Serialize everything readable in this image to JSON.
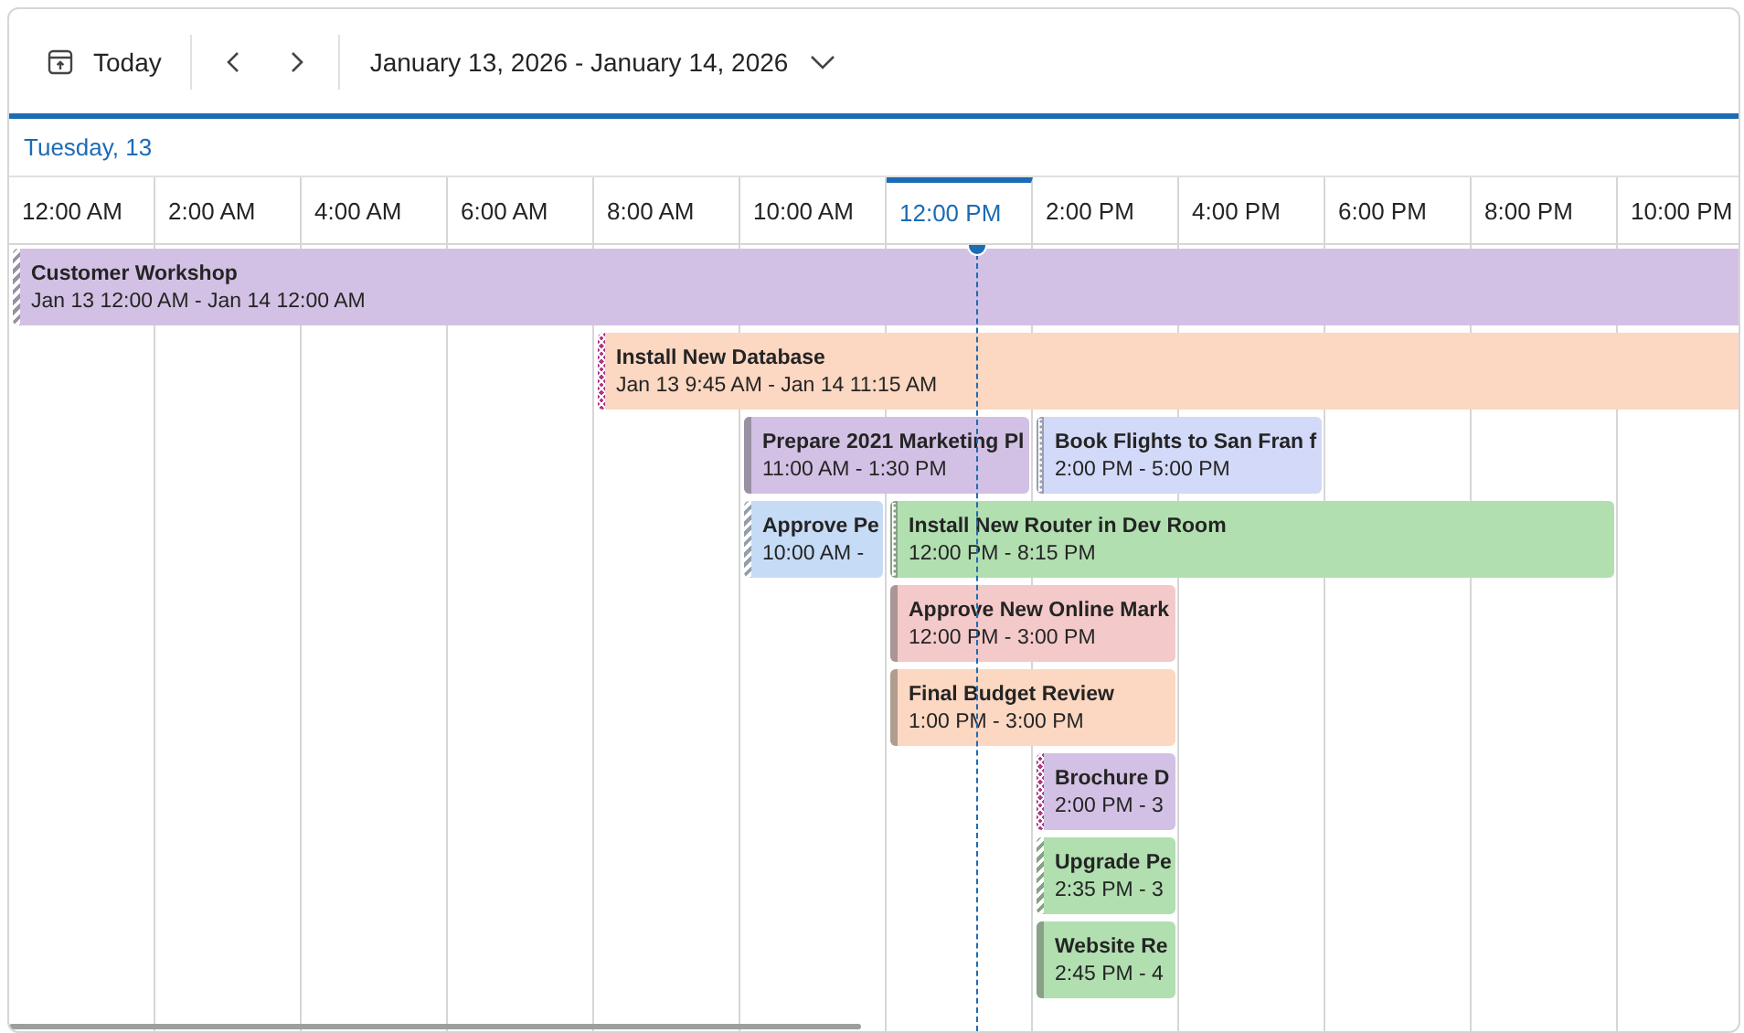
{
  "toolbar": {
    "today": "Today",
    "date_range": "January 13, 2026 - January 14, 2026"
  },
  "day_label": "Tuesday, 13",
  "time_slots": [
    {
      "label": "12:00 AM",
      "selected": false
    },
    {
      "label": "2:00 AM",
      "selected": false
    },
    {
      "label": "4:00 AM",
      "selected": false
    },
    {
      "label": "6:00 AM",
      "selected": false
    },
    {
      "label": "8:00 AM",
      "selected": false
    },
    {
      "label": "10:00 AM",
      "selected": false
    },
    {
      "label": "12:00 PM",
      "selected": true
    },
    {
      "label": "2:00 PM",
      "selected": false
    },
    {
      "label": "4:00 PM",
      "selected": false
    },
    {
      "label": "6:00 PM",
      "selected": false
    },
    {
      "label": "8:00 PM",
      "selected": false
    },
    {
      "label": "10:00 PM",
      "selected": false
    }
  ],
  "events": [
    {
      "title": "Customer Workshop",
      "time": "Jan 13 12:00 AM - Jan 14 12:00 AM",
      "color": "#d2c1e4",
      "kind": "striped"
    },
    {
      "title": "Install New Database",
      "time": "Jan 13 9:45 AM - Jan 14 11:15 AM",
      "color": "#fcd7c1",
      "kind": "crosshatch"
    },
    {
      "title": "Prepare 2021 Marketing Pl",
      "time": "11:00 AM - 1:30 PM",
      "color": "#d2c1e4",
      "kind": "solid"
    },
    {
      "title": "Book Flights to San Fran f",
      "time": "2:00 PM - 5:00 PM",
      "color": "#d3d9f8",
      "kind": "dotted"
    },
    {
      "title": "Approve Pe",
      "time": "10:00 AM -",
      "color": "#c6dbf5",
      "kind": "striped"
    },
    {
      "title": "Install New Router in Dev Room",
      "time": "12:00 PM - 8:15 PM",
      "color": "#b1dfb0",
      "kind": "dotted"
    },
    {
      "title": "Approve New Online Mark",
      "time": "12:00 PM - 3:00 PM",
      "color": "#f3c9c9",
      "kind": "solid"
    },
    {
      "title": "Final Budget Review",
      "time": "1:00 PM - 3:00 PM",
      "color": "#fcd7c1",
      "kind": "solid"
    },
    {
      "title": "Brochure D",
      "time": "2:00 PM - 3",
      "color": "#d2c1e4",
      "kind": "crosshatch"
    },
    {
      "title": "Upgrade Pe",
      "time": "2:35 PM - 3",
      "color": "#b1dfb0",
      "kind": "striped"
    },
    {
      "title": "Website Re",
      "time": "2:45 PM - 4",
      "color": "#b1dfb0",
      "kind": "solid"
    }
  ]
}
